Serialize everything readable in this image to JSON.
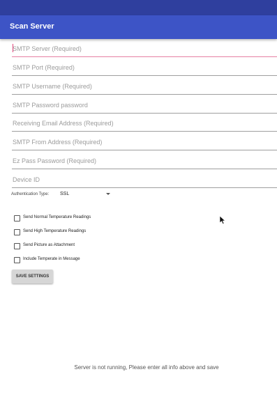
{
  "app_bar": {
    "title": "Scan Server"
  },
  "fields": [
    {
      "placeholder": "SMTP Server (Required)",
      "value": ""
    },
    {
      "placeholder": "SMTP Port (Required)",
      "value": ""
    },
    {
      "placeholder": "SMTP Username (Required)",
      "value": ""
    },
    {
      "placeholder": "SMTP Password password",
      "value": ""
    },
    {
      "placeholder": "Receiving Email Address (Required)",
      "value": ""
    },
    {
      "placeholder": "SMTP From Address (Required)",
      "value": ""
    },
    {
      "placeholder": "Ez Pass Password (Required)",
      "value": ""
    },
    {
      "placeholder": "Device ID",
      "value": ""
    }
  ],
  "authentication": {
    "label": "Authentication Type:",
    "selected": "SSL"
  },
  "checkboxes": [
    {
      "label": "Send Normal Temperature Readings",
      "checked": false
    },
    {
      "label": "Send High Temperature Readings",
      "checked": false
    },
    {
      "label": "Send Picture as Attachment",
      "checked": false
    },
    {
      "label": "Include Temperate in Message",
      "checked": false
    }
  ],
  "save_button": {
    "label": "SAVE SETTINGS"
  },
  "status": {
    "message": "Server is not running, Please enter all info above and save"
  },
  "colors": {
    "status_bar": "#2f3f9e",
    "app_bar": "#3d54c6",
    "focus_accent": "#e0447a"
  }
}
